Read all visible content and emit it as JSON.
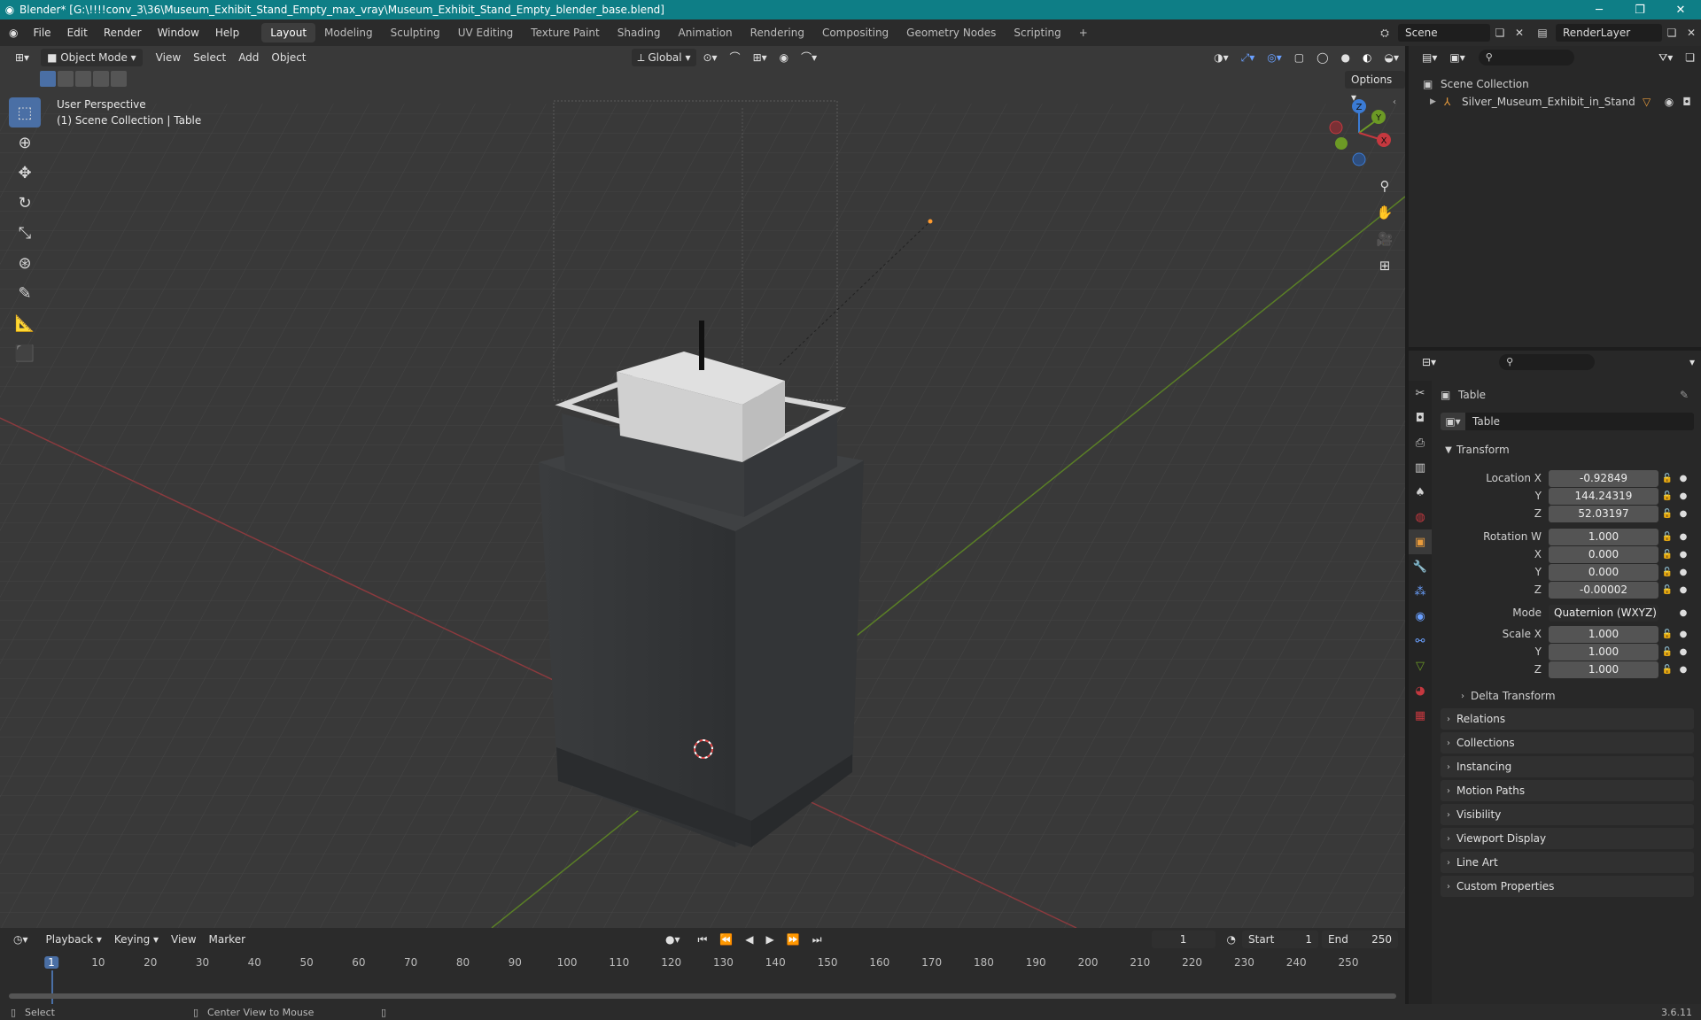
{
  "window": {
    "title": "Blender* [G:\\!!!!conv_3\\36\\Museum_Exhibit_Stand_Empty_max_vray\\Museum_Exhibit_Stand_Empty_blender_base.blend]",
    "minimize": "─",
    "maximize": "❐",
    "close": "✕"
  },
  "menu": [
    "File",
    "Edit",
    "Render",
    "Window",
    "Help"
  ],
  "workspaces": [
    "Layout",
    "Modeling",
    "Sculpting",
    "UV Editing",
    "Texture Paint",
    "Shading",
    "Animation",
    "Rendering",
    "Compositing",
    "Geometry Nodes",
    "Scripting",
    "+"
  ],
  "active_workspace": "Layout",
  "scene": {
    "name": "Scene",
    "render_layer": "RenderLayer"
  },
  "viewport": {
    "mode": "Object Mode",
    "menus": [
      "View",
      "Select",
      "Add",
      "Object"
    ],
    "orientation": "Global",
    "options": "Options",
    "perspective": "User Perspective",
    "collection_info": "(1) Scene Collection | Table",
    "gizmo": {
      "z": "Z",
      "y": "Y",
      "x": "X"
    }
  },
  "outliner": {
    "root": "Scene Collection",
    "items": [
      {
        "name": "Silver_Museum_Exhibit_in_Stand"
      }
    ]
  },
  "properties": {
    "object_name": "Table",
    "data_name": "Table",
    "section": "Transform",
    "location": {
      "label": "Location X",
      "x": "-0.92849",
      "y": "144.24319",
      "z": "52.03197"
    },
    "rotation": {
      "label": "Rotation W",
      "w": "1.000",
      "x": "0.000",
      "y": "0.000",
      "z": "-0.00002"
    },
    "mode_label": "Mode",
    "mode_value": "Quaternion (WXYZ)",
    "scale": {
      "label": "Scale X",
      "x": "1.000",
      "y": "1.000",
      "z": "1.000"
    },
    "axis": {
      "y": "Y",
      "z": "Z",
      "x": "X"
    },
    "delta": "Delta Transform",
    "panels": [
      "Relations",
      "Collections",
      "Instancing",
      "Motion Paths",
      "Visibility",
      "Viewport Display",
      "Line Art",
      "Custom Properties"
    ]
  },
  "timeline": {
    "menus": [
      "Playback",
      "Keying",
      "View",
      "Marker"
    ],
    "current_frame": "1",
    "start_label": "Start",
    "start": "1",
    "end_label": "End",
    "end": "250",
    "ticks": [
      "1",
      "10",
      "20",
      "30",
      "40",
      "50",
      "60",
      "70",
      "80",
      "90",
      "100",
      "110",
      "120",
      "130",
      "140",
      "150",
      "160",
      "170",
      "180",
      "190",
      "200",
      "210",
      "220",
      "230",
      "240",
      "250"
    ]
  },
  "status": {
    "select": "Select",
    "center": "Center View to Mouse",
    "version": "3.6.11"
  },
  "colors": {
    "accent": "#4a6fa5",
    "titlebar": "#0e7e86",
    "x_axis": "#c5383f",
    "y_axis": "#6c9a25",
    "z_axis": "#3b7bd4"
  }
}
